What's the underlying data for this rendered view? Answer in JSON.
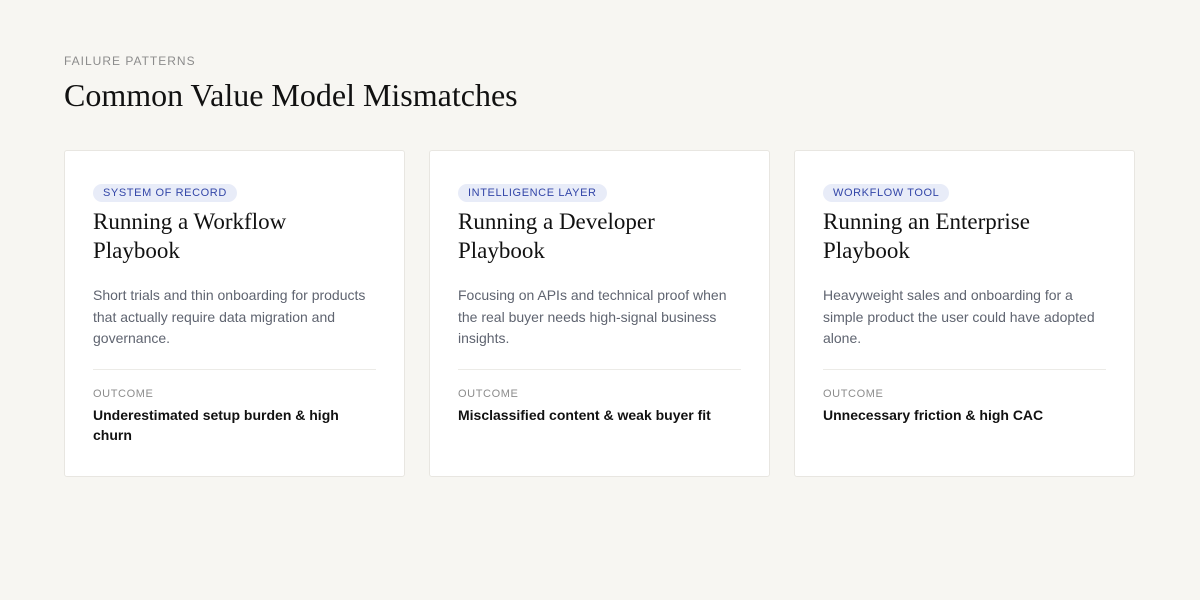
{
  "section": {
    "eyebrow": "FAILURE PATTERNS",
    "title": "Common Value Model Mismatches"
  },
  "cards": [
    {
      "tag": "SYSTEM OF RECORD",
      "title": "Running a Workflow Playbook",
      "description": "Short trials and thin onboarding for products that actually require data migration and governance.",
      "outcome_label": "OUTCOME",
      "outcome": "Underestimated setup burden & high churn"
    },
    {
      "tag": "INTELLIGENCE LAYER",
      "title": "Running a Developer Playbook",
      "description": "Focusing on APIs and technical proof when the real buyer needs high-signal business insights.",
      "outcome_label": "OUTCOME",
      "outcome": "Misclassified content & weak buyer fit"
    },
    {
      "tag": "WORKFLOW TOOL",
      "title": "Running an Enterprise Playbook",
      "description": "Heavyweight sales and onboarding for a simple product the user could have adopted alone.",
      "outcome_label": "OUTCOME",
      "outcome": "Unnecessary friction & high CAC"
    }
  ],
  "colors": {
    "background": "#f7f6f2",
    "card_background": "#ffffff",
    "tag_background": "#e8ecf8",
    "tag_text": "#3346a8",
    "muted_text": "#8c8c8c",
    "body_text": "#5f6470"
  }
}
